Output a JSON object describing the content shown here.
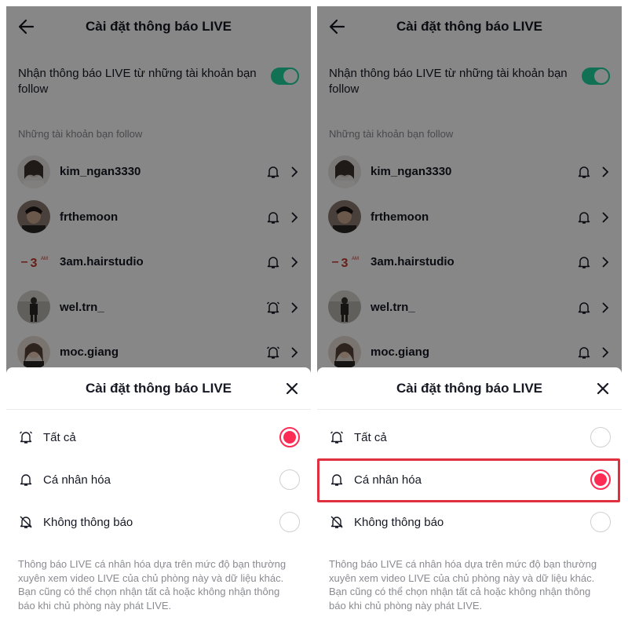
{
  "header": {
    "title": "Cài đặt thông báo LIVE"
  },
  "toggle_row": {
    "label": "Nhận thông báo LIVE từ những tài khoản bạn follow",
    "state": "on"
  },
  "section_label": "Những tài khoản bạn follow",
  "accounts": [
    {
      "name": "kim_ngan3330",
      "bell": "bell-icon"
    },
    {
      "name": "frthemoon",
      "bell": "bell-icon"
    },
    {
      "name": "3am.hairstudio",
      "bell": "bell-icon"
    },
    {
      "name": "wel.trn_",
      "bell": "bell-ringing-icon"
    },
    {
      "name": "moc.giang",
      "bell": "bell-ringing-icon"
    }
  ],
  "sheet": {
    "title": "Cài đặt thông báo LIVE",
    "options": [
      {
        "label": "Tất cả",
        "icon": "bell-ringing-icon"
      },
      {
        "label": "Cá nhân hóa",
        "icon": "bell-icon"
      },
      {
        "label": "Không thông báo",
        "icon": "bell-off-icon"
      }
    ],
    "description": "Thông báo LIVE cá nhân hóa dựa trên mức độ bạn thường xuyên xem video LIVE của chủ phòng này và dữ liệu khác. Bạn cũng có thể chọn nhận tất cả hoặc không nhận thông báo khi chủ phòng này phát LIVE."
  },
  "panels": {
    "left": {
      "selected_option": "Tất cả"
    },
    "right": {
      "selected_option": "Cá nhân hóa",
      "highlighted_option": "Cá nhân hóa"
    }
  },
  "colors": {
    "accent": "#fe2c55",
    "toggle": "#20d5a0",
    "highlight": "#e0303f"
  }
}
